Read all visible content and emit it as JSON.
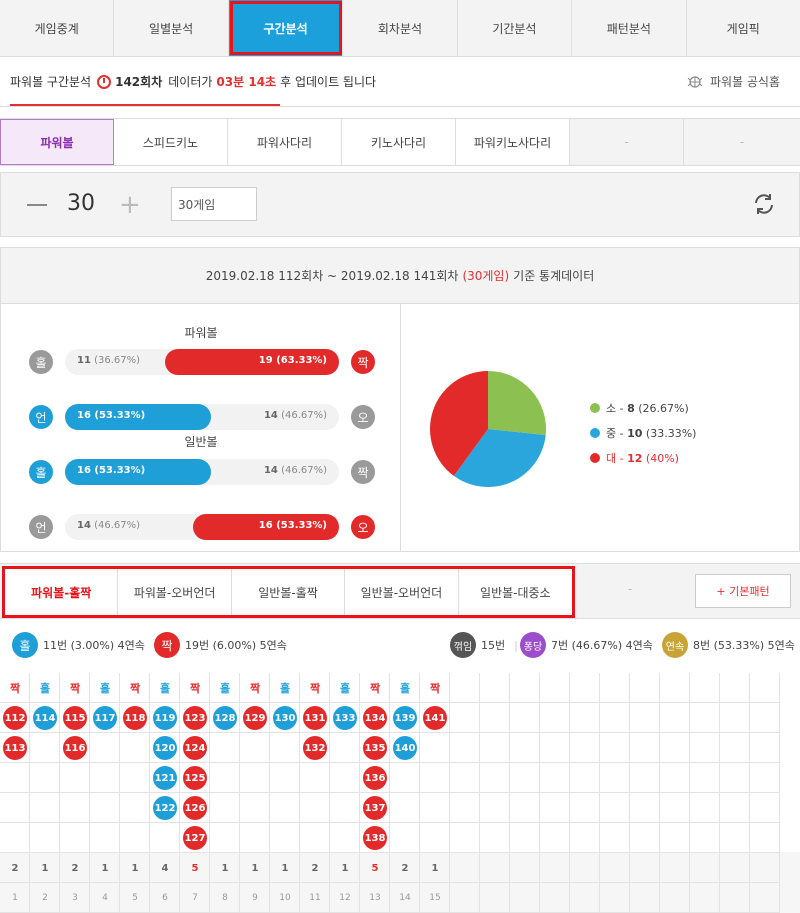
{
  "top_tabs": [
    "게임중계",
    "일별분석",
    "구간분석",
    "회차분석",
    "기간분석",
    "패턴분석",
    "게임픽"
  ],
  "info": {
    "prefix": "파워볼 구간분석",
    "round": "142회차",
    "mid": "데이터가",
    "countdown": "03분 14초",
    "suffix": "후 업데이트 됩니다",
    "home_link": "파워볼 공식홈"
  },
  "game_tabs": [
    "파워볼",
    "스피드키노",
    "파워사다리",
    "키노사다리",
    "파워키노사다리",
    "-",
    "-"
  ],
  "control": {
    "count": "30",
    "select_value": "30게임"
  },
  "stats": {
    "header_main": "2019.02.18 112회차 ~ 2019.02.18 141회차",
    "header_games": "(30게임)",
    "header_suffix": "기준 통계데이터",
    "powerball_title": "파워볼",
    "normal_title": "일반볼",
    "rows": [
      {
        "left_badge": "홀",
        "right_badge": "짝",
        "left_count": "11",
        "left_pct": "(36.67%)",
        "right_count": "19",
        "right_pct": "(63.33%)",
        "left_share": 0.3667,
        "winner": "right",
        "left_color": "#9a9a9a",
        "right_color": "#e32a2a"
      },
      {
        "left_badge": "언",
        "right_badge": "오",
        "left_count": "16",
        "left_pct": "(53.33%)",
        "right_count": "14",
        "right_pct": "(46.67%)",
        "left_share": 0.5333,
        "winner": "left",
        "left_color": "#1f9fd8",
        "right_color": "#9a9a9a"
      },
      {
        "left_badge": "홀",
        "right_badge": "짝",
        "left_count": "16",
        "left_pct": "(53.33%)",
        "right_count": "14",
        "right_pct": "(46.67%)",
        "left_share": 0.5333,
        "winner": "left",
        "left_color": "#1f9fd8",
        "right_color": "#9a9a9a"
      },
      {
        "left_badge": "언",
        "right_badge": "오",
        "left_count": "14",
        "left_pct": "(46.67%)",
        "right_count": "16",
        "right_pct": "(53.33%)",
        "left_share": 0.4667,
        "winner": "right",
        "left_color": "#9a9a9a",
        "right_color": "#e32a2a"
      }
    ]
  },
  "chart_data": {
    "type": "pie",
    "slices": [
      {
        "label": "소",
        "value": 8,
        "pct": "(26.67%)",
        "color": "#8cc152"
      },
      {
        "label": "중",
        "value": 10,
        "pct": "(33.33%)",
        "color": "#2aa6dd"
      },
      {
        "label": "대",
        "value": 12,
        "pct": "(40%)",
        "color": "#e32a2a"
      }
    ]
  },
  "pattern_tabs": [
    "파워볼-홀짝",
    "파워볼-오버언더",
    "일반볼-홀짝",
    "일반볼-오버언더",
    "일반볼-대중소"
  ],
  "pattern_dash": "-",
  "basic_pattern": "+ 기본패턴",
  "summary": {
    "odd_badge": "홀",
    "odd_text": "11번 (3.00%) 4연속",
    "even_badge": "짝",
    "even_text": "19번 (6.00%) 5연속",
    "bend_badge": "꺾임",
    "bend_text": "15번",
    "pong_badge": "퐁당",
    "pong_text": "7번 (46.67%) 4연속",
    "run_badge": "연속",
    "run_text": "8번 (53.33%) 5연속"
  },
  "pattern_grid": {
    "columns": [
      {
        "head": "짝",
        "type": "even",
        "balls": [
          "112",
          "113"
        ]
      },
      {
        "head": "홀",
        "type": "odd",
        "balls": [
          "114"
        ]
      },
      {
        "head": "짝",
        "type": "even",
        "balls": [
          "115",
          "116"
        ]
      },
      {
        "head": "홀",
        "type": "odd",
        "balls": [
          "117"
        ]
      },
      {
        "head": "짝",
        "type": "even",
        "balls": [
          "118"
        ]
      },
      {
        "head": "홀",
        "type": "odd",
        "balls": [
          "119",
          "120",
          "121",
          "122"
        ]
      },
      {
        "head": "짝",
        "type": "even",
        "balls": [
          "123",
          "124",
          "125",
          "126",
          "127"
        ]
      },
      {
        "head": "홀",
        "type": "odd",
        "balls": [
          "128"
        ]
      },
      {
        "head": "짝",
        "type": "even",
        "balls": [
          "129"
        ]
      },
      {
        "head": "홀",
        "type": "odd",
        "balls": [
          "130"
        ]
      },
      {
        "head": "짝",
        "type": "even",
        "balls": [
          "131",
          "132"
        ]
      },
      {
        "head": "홀",
        "type": "odd",
        "balls": [
          "133"
        ]
      },
      {
        "head": "짝",
        "type": "even",
        "balls": [
          "134",
          "135",
          "136",
          "137",
          "138"
        ]
      },
      {
        "head": "홀",
        "type": "odd",
        "balls": [
          "139",
          "140"
        ]
      },
      {
        "head": "짝",
        "type": "even",
        "balls": [
          "141"
        ]
      }
    ],
    "counts": [
      "2",
      "1",
      "2",
      "1",
      "1",
      "4",
      "5",
      "1",
      "1",
      "1",
      "2",
      "1",
      "5",
      "2",
      "1"
    ],
    "index": [
      "1",
      "2",
      "3",
      "4",
      "5",
      "6",
      "7",
      "8",
      "9",
      "10",
      "11",
      "12",
      "13",
      "14",
      "15"
    ],
    "highlight_counts": [
      "5"
    ]
  },
  "colors": {
    "even": "#e32a2a",
    "odd": "#1f9fd8",
    "accent": "#1ba0dc"
  }
}
